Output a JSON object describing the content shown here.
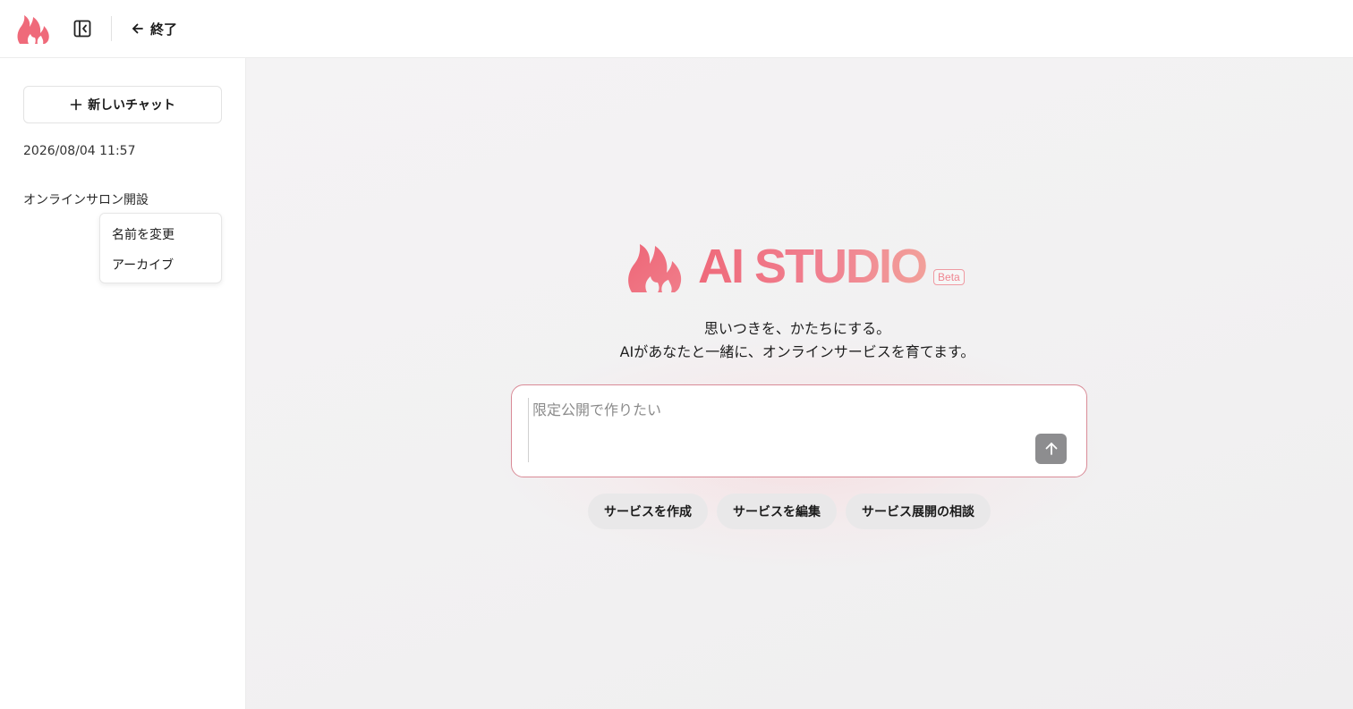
{
  "header": {
    "logo_icon": "flame-logo-icon",
    "toggle_icon": "sidebar-toggle-icon",
    "exit_label": "終了",
    "exit_icon": "arrow-left-icon"
  },
  "sidebar": {
    "new_chat_label": "新しいチャット",
    "new_chat_icon": "plus-icon",
    "history": [
      {
        "label": "2026/08/04 11:57"
      },
      {
        "label": "オンラインサロン開設"
      }
    ],
    "context_menu": {
      "rename_label": "名前を変更",
      "archive_label": "アーカイブ"
    }
  },
  "main": {
    "brand_name": "AI STUDIO",
    "brand_badge": "Beta",
    "tagline_line1": "思いつきを、かたちにする。",
    "tagline_line2": "AIがあなたと一緒に、オンラインサービスを育てます。",
    "composer": {
      "placeholder": "限定公開で作りたい",
      "value": "",
      "send_icon": "arrow-up-icon"
    },
    "suggestions": [
      {
        "label": "サービスを作成"
      },
      {
        "label": "サービスを編集"
      },
      {
        "label": "サービス展開の相談"
      }
    ]
  },
  "colors": {
    "brand": "#ef6a7a",
    "brand_light": "#f2a09a",
    "send_button": "#8d8d8f",
    "composer_border": "#d98b97"
  }
}
